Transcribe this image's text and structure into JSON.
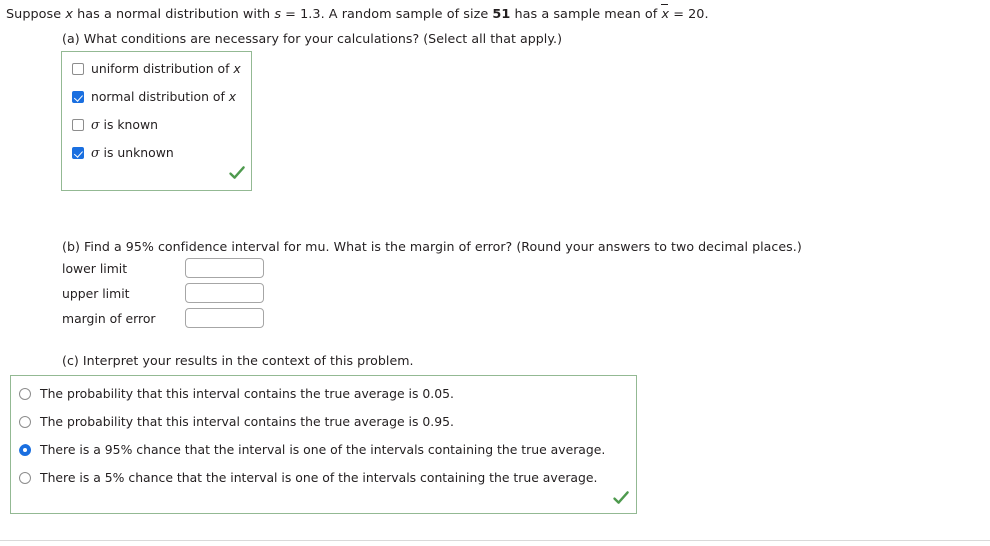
{
  "problem": {
    "stem": {
      "s1": "Suppose ",
      "var_x": "x",
      "s2": " has a normal distribution with ",
      "var_s": "s",
      "s3": " = 1.3. A random sample of size ",
      "sample_size": "51",
      "s4": " has a sample mean of ",
      "var_xbar": "x",
      "s5": " = 20."
    }
  },
  "part_a": {
    "label": "(a) What conditions are necessary for your calculations? (Select all that apply.)",
    "options": [
      {
        "text": "uniform distribution of ",
        "var": "x",
        "checked": false
      },
      {
        "text": "normal distribution of ",
        "var": "x",
        "checked": true
      },
      {
        "sigma": "σ",
        "text": " is known",
        "checked": false
      },
      {
        "sigma": "σ",
        "text": " is unknown",
        "checked": true
      }
    ],
    "status_icon": "green-check-icon"
  },
  "part_b": {
    "label": "(b) Find a 95% confidence interval for mu. What is the margin of error? (Round your answers to two decimal places.)",
    "fields": [
      {
        "label": "lower limit",
        "value": "",
        "placeholder": ""
      },
      {
        "label": "upper limit",
        "value": "",
        "placeholder": ""
      },
      {
        "label": "margin of error",
        "value": "",
        "placeholder": ""
      }
    ]
  },
  "part_c": {
    "label": "(c) Interpret your results in the context of this problem.",
    "options": [
      {
        "text": "The probability that this interval contains the true average is 0.05.",
        "selected": false
      },
      {
        "text": "The probability that this interval contains the true average is 0.95.",
        "selected": false
      },
      {
        "text": "There is a 95% chance that the interval is one of the intervals containing the true average.",
        "selected": true
      },
      {
        "text": "There is a 5% chance that the interval is one of the intervals containing the true average.",
        "selected": false
      }
    ],
    "status_icon": "green-check-icon"
  },
  "colors": {
    "answer_box_border": "#93b993",
    "control_accent": "#1a6fe0",
    "success_check": "#4e9a4e",
    "text": "#231f20"
  }
}
